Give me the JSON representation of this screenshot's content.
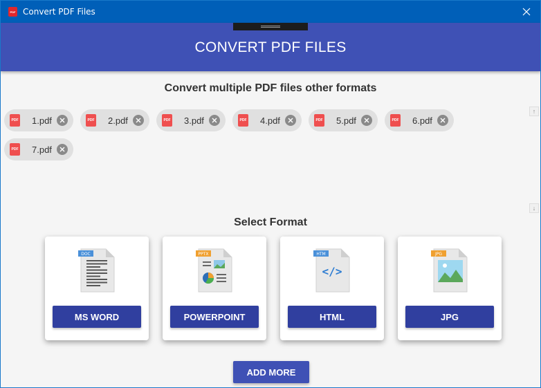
{
  "window": {
    "title": "Convert PDF Files",
    "app_icon_text": "PDF"
  },
  "header": {
    "title": "CONVERT PDF FILES"
  },
  "files_section": {
    "heading": "Convert multiple PDF files other formats",
    "pdf_icon_text": "PDF",
    "files": [
      {
        "name": "1.pdf"
      },
      {
        "name": "2.pdf"
      },
      {
        "name": "3.pdf"
      },
      {
        "name": "4.pdf"
      },
      {
        "name": "5.pdf"
      },
      {
        "name": "6.pdf"
      },
      {
        "name": "7.pdf"
      }
    ],
    "scroll_up_glyph": "↑",
    "scroll_down_glyph": "↓"
  },
  "format_section": {
    "heading": "Select Format",
    "formats": [
      {
        "badge": "DOC",
        "label": "MS WORD",
        "icon": "doc-file-icon",
        "badge_color": "#4a90d9"
      },
      {
        "badge": "PPTX",
        "label": "POWERPOINT",
        "icon": "pptx-file-icon",
        "badge_color": "#f0a030"
      },
      {
        "badge": "HTM",
        "label": "HTML",
        "icon": "html-file-icon",
        "badge_color": "#4a90d9"
      },
      {
        "badge": "JPG",
        "label": "JPG",
        "icon": "jpg-file-icon",
        "badge_color": "#f0a030"
      }
    ]
  },
  "actions": {
    "add_more_label": "ADD MORE"
  },
  "colors": {
    "titlebar": "#005fb8",
    "header": "#3f51b5",
    "card_button": "#303f9f",
    "pdf_red": "#ef4f4f"
  }
}
